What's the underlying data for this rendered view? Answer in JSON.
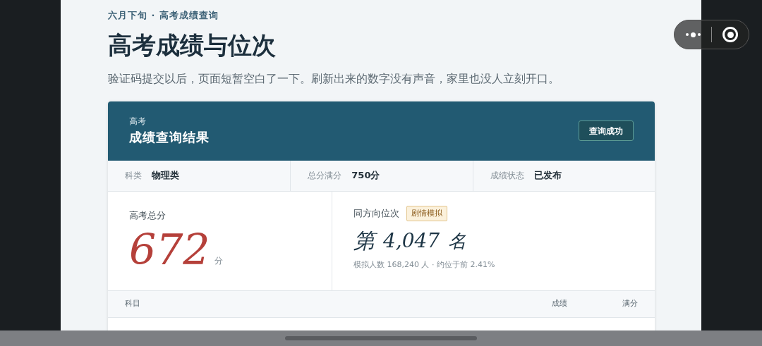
{
  "eyebrow": "六月下旬 · 高考成绩查询",
  "title": "高考成绩与位次",
  "description": "验证码提交以后，页面短暂空白了一下。刷新出来的数字没有声音，家里也没人立刻开口。",
  "card": {
    "subtitle": "高考",
    "title": "成绩查询结果",
    "status_button": "查询成功"
  },
  "info": [
    {
      "label": "科类",
      "value": "物理类"
    },
    {
      "label": "总分满分",
      "value": "750分"
    },
    {
      "label": "成绩状态",
      "value": "已发布"
    }
  ],
  "total": {
    "label": "高考总分",
    "score": "672",
    "unit": "分"
  },
  "rank": {
    "label": "同方向位次",
    "tag": "剧情模拟",
    "prefix": "第",
    "number": "4,047",
    "suffix": "名",
    "note": "模拟人数 168,240 人 · 约位于前 2.41%"
  },
  "table": {
    "columns": [
      "科目",
      "成绩",
      "满分"
    ]
  }
}
